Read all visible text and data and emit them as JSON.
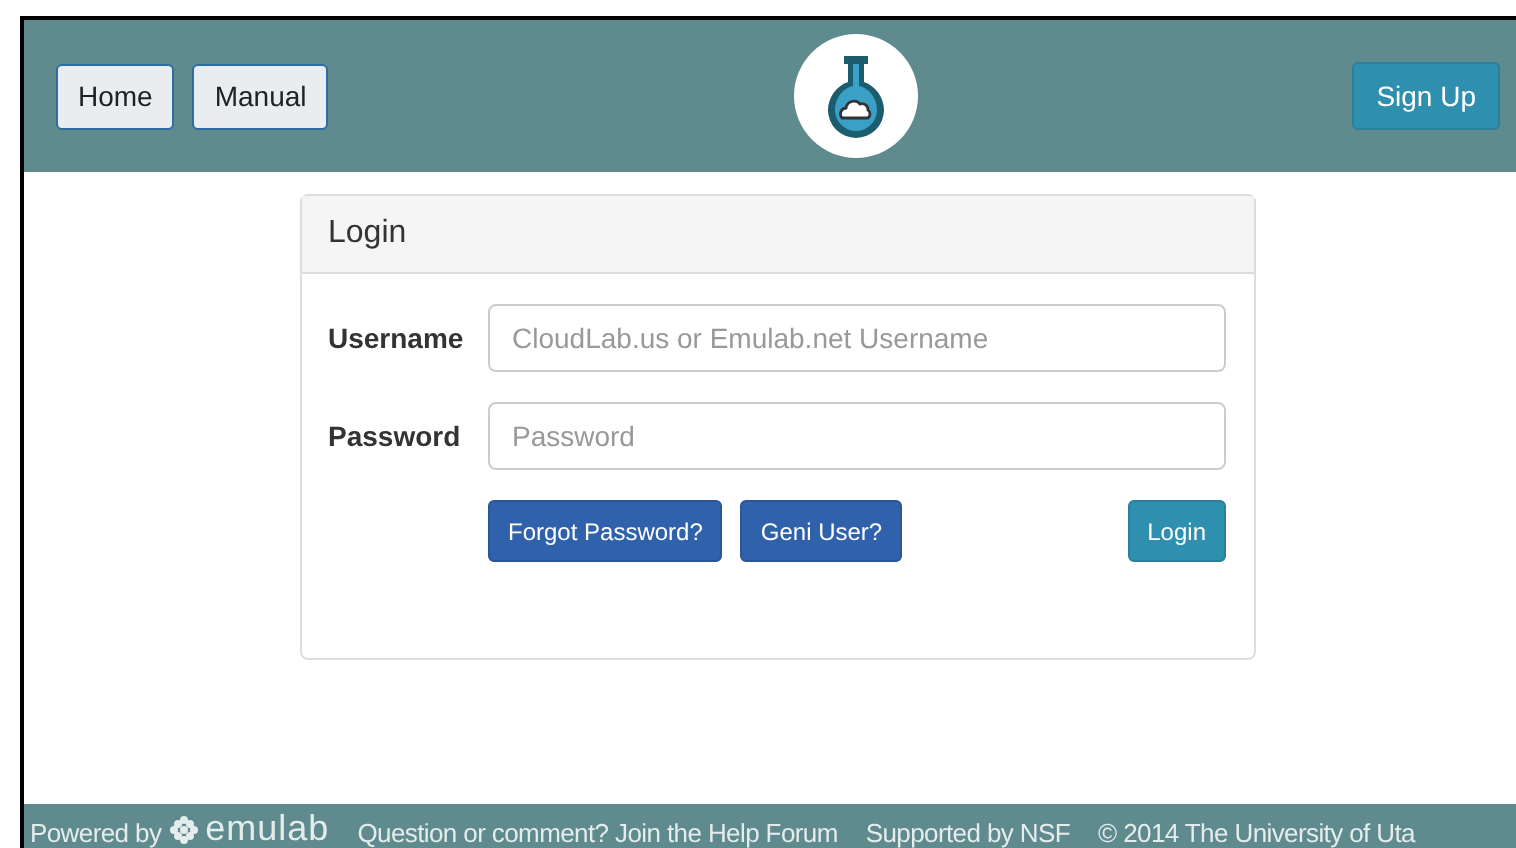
{
  "navbar": {
    "buttons": [
      {
        "label": "Home"
      },
      {
        "label": "Manual"
      }
    ],
    "signup": "Sign Up"
  },
  "login": {
    "title": "Login",
    "fields": [
      {
        "label": "Username",
        "placeholder": "CloudLab.us or Emulab.net Username"
      },
      {
        "label": "Password",
        "placeholder": "Password"
      }
    ],
    "links": [
      {
        "label": "Forgot Password?"
      },
      {
        "label": "Geni User?"
      }
    ],
    "submit": "Login"
  },
  "footer": {
    "powered_by": "Powered by",
    "logo": "emulab",
    "items": [
      "Question or comment? Join the Help Forum",
      "Supported by NSF",
      "© 2014 The University of Uta"
    ]
  }
}
